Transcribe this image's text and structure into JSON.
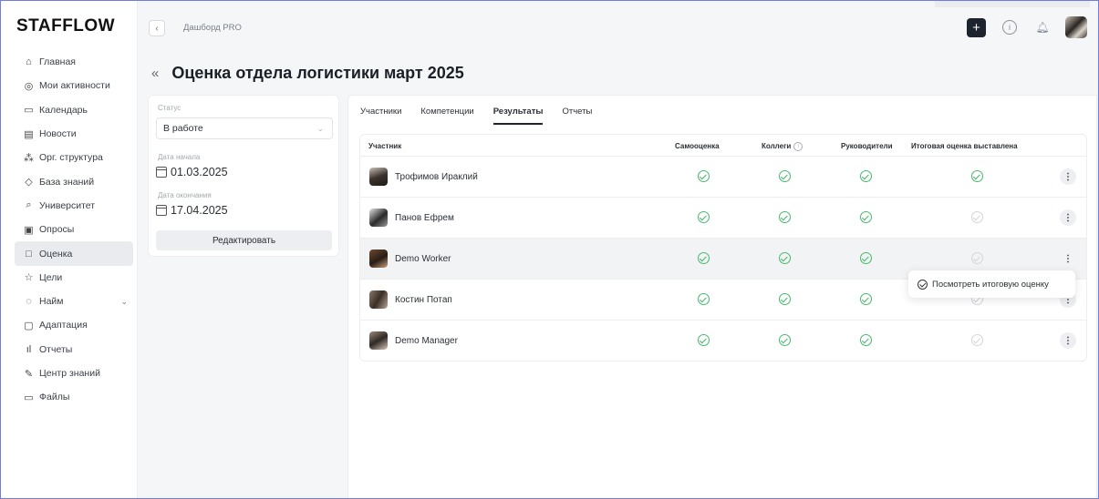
{
  "app": {
    "logo": "STAFFLOW"
  },
  "sidebar": {
    "items": [
      {
        "label": "Главная",
        "icon": "home-icon"
      },
      {
        "label": "Мои активности",
        "icon": "activity-icon"
      },
      {
        "label": "Календарь",
        "icon": "calendar-icon"
      },
      {
        "label": "Новости",
        "icon": "news-icon"
      },
      {
        "label": "Орг. структура",
        "icon": "org-structure-icon"
      },
      {
        "label": "База знаний",
        "icon": "knowledge-base-icon"
      },
      {
        "label": "Университет",
        "icon": "university-icon"
      },
      {
        "label": "Опросы",
        "icon": "survey-icon"
      },
      {
        "label": "Оценка",
        "icon": "assessment-icon",
        "active": true
      },
      {
        "label": "Цели",
        "icon": "star-icon"
      },
      {
        "label": "Найм",
        "icon": "hiring-icon",
        "expandable": true
      },
      {
        "label": "Адаптация",
        "icon": "adaptation-icon"
      },
      {
        "label": "Отчеты",
        "icon": "reports-icon"
      },
      {
        "label": "Центр знаний",
        "icon": "edit-icon"
      },
      {
        "label": "Файлы",
        "icon": "folder-icon"
      }
    ]
  },
  "topbar": {
    "breadcrumb": "Дашборд PRO"
  },
  "page": {
    "title": "Оценка отдела логистики март 2025"
  },
  "details": {
    "status_label": "Статус",
    "status_value": "В работе",
    "start_label": "Дата начала",
    "start_value": "01.03.2025",
    "end_label": "Дата окончания",
    "end_value": "17.04.2025",
    "edit_button": "Редактировать"
  },
  "tabs": [
    {
      "label": "Участники"
    },
    {
      "label": "Компетенции"
    },
    {
      "label": "Результаты",
      "active": true
    },
    {
      "label": "Отчеты"
    }
  ],
  "table": {
    "columns": {
      "participant": "Участник",
      "self": "Самооценка",
      "colleagues": "Коллеги",
      "managers": "Руководители",
      "final": "Итоговая оценка выставлена"
    },
    "rows": [
      {
        "name": "Трофимов Ираклий",
        "self": true,
        "colleagues": true,
        "managers": true,
        "final": true
      },
      {
        "name": "Панов Ефрем",
        "self": true,
        "colleagues": true,
        "managers": true,
        "final": false
      },
      {
        "name": "Demo Worker",
        "self": true,
        "colleagues": true,
        "managers": true,
        "final": false,
        "highlighted": true
      },
      {
        "name": "Костин Потап",
        "self": true,
        "colleagues": true,
        "managers": true,
        "final": false
      },
      {
        "name": "Demo Manager",
        "self": true,
        "colleagues": true,
        "managers": true,
        "final": false
      }
    ]
  },
  "popup": {
    "label": "Посмотреть итоговую оценку"
  },
  "colors": {
    "accent": "#1d2430",
    "check": "#46b86b",
    "check_dim": "#d2d5da"
  }
}
